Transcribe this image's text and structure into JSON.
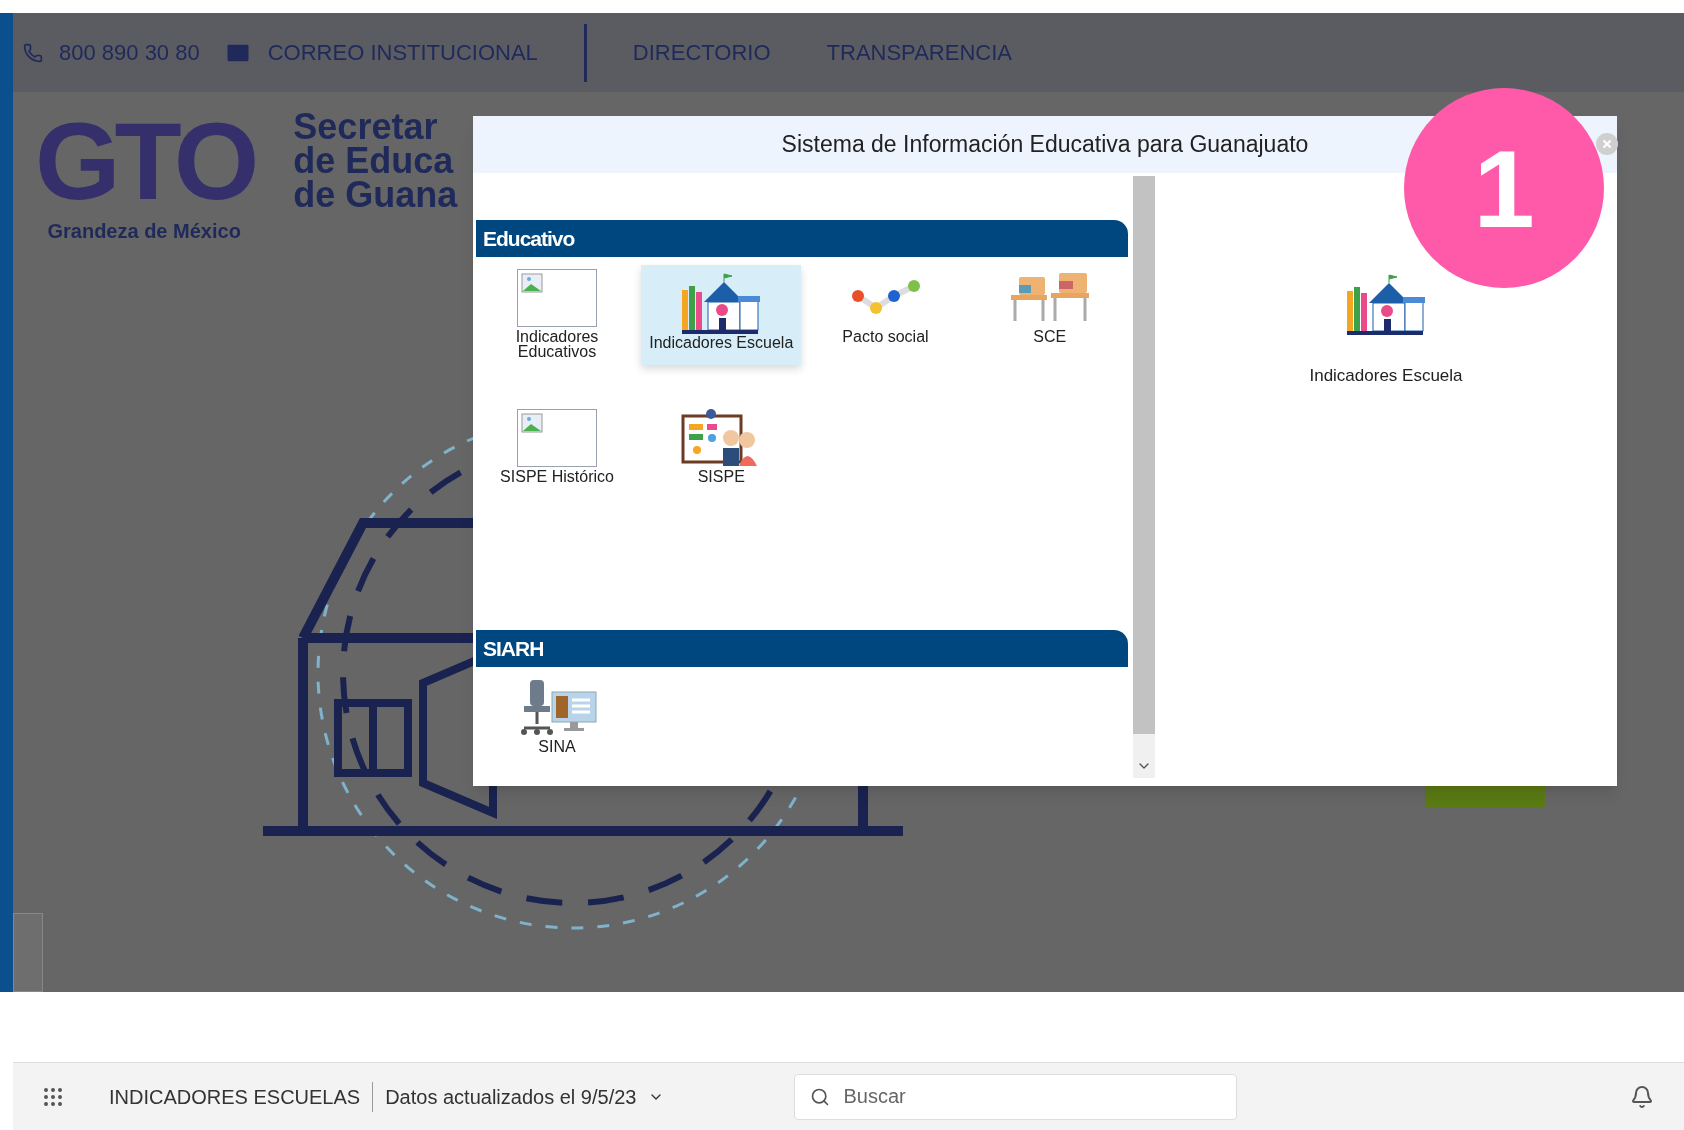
{
  "top_bar": {
    "phone": "800 890 30 80",
    "links": [
      "CORREO INSTITUCIONAL",
      "DIRECTORIO",
      "TRANSPARENCIA"
    ]
  },
  "logo": {
    "mark": "GTO",
    "tagline": "Grandeza de México",
    "title_lines": [
      "Secretar",
      "de Educa",
      "de Guana"
    ]
  },
  "modal": {
    "title": "Sistema de Información Educativa para Guanajuato",
    "sections": [
      {
        "title": "Educativo",
        "items": [
          {
            "label": "Indicadores Educativos",
            "kind": "broken",
            "selected": false
          },
          {
            "label": "Indicadores Escuela",
            "kind": "school",
            "selected": true
          },
          {
            "label": "Pacto social",
            "kind": "dots",
            "selected": false
          },
          {
            "label": "SCE",
            "kind": "desks",
            "selected": false
          },
          {
            "label": "SISPE Histórico",
            "kind": "broken",
            "selected": false
          },
          {
            "label": "SISPE",
            "kind": "board",
            "selected": false
          }
        ]
      },
      {
        "title": "SIARH",
        "items": [
          {
            "label": "SINA",
            "kind": "office",
            "selected": false
          }
        ]
      }
    ],
    "preview": {
      "label": "Indicadores Escuela",
      "kind": "school"
    }
  },
  "step_badge": "1",
  "bottom_bar": {
    "app_title": "INDICADORES ESCUELAS",
    "updated": "Datos actualizados el 9/5/23",
    "search": {
      "placeholder": "Buscar"
    }
  }
}
